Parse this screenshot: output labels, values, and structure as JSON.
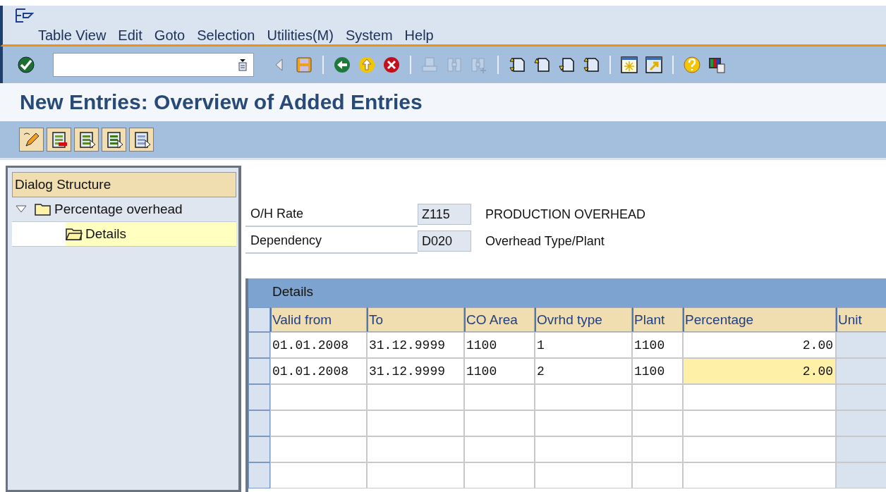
{
  "menu_bar": {
    "items": [
      {
        "label": "Table View"
      },
      {
        "label": "Edit"
      },
      {
        "label": "Goto"
      },
      {
        "label": "Selection"
      },
      {
        "label": "Utilities(M)"
      },
      {
        "label": "System"
      },
      {
        "label": "Help"
      }
    ]
  },
  "toolbar": {
    "buttons": [
      {
        "kind": "back-triangle",
        "disabled": false
      },
      {
        "kind": "save",
        "disabled": false
      },
      {
        "kind": "sep"
      },
      {
        "kind": "back",
        "disabled": false
      },
      {
        "kind": "exit",
        "disabled": false
      },
      {
        "kind": "cancel",
        "disabled": false
      },
      {
        "kind": "sep"
      },
      {
        "kind": "print",
        "disabled": true
      },
      {
        "kind": "find",
        "disabled": true
      },
      {
        "kind": "find-next",
        "disabled": true
      },
      {
        "kind": "sep"
      },
      {
        "kind": "first-page",
        "disabled": false
      },
      {
        "kind": "prev-page",
        "disabled": false
      },
      {
        "kind": "next-page",
        "disabled": false
      },
      {
        "kind": "last-page",
        "disabled": false
      },
      {
        "kind": "sep"
      },
      {
        "kind": "new-session",
        "disabled": false
      },
      {
        "kind": "shortcut",
        "disabled": false
      },
      {
        "kind": "sep"
      },
      {
        "kind": "help",
        "disabled": false
      },
      {
        "kind": "layout",
        "disabled": false
      }
    ]
  },
  "title": "New Entries: Overview of Added Entries",
  "app_toolbar": {
    "buttons": [
      {
        "kind": "change"
      },
      {
        "kind": "delete"
      },
      {
        "kind": "select-all"
      },
      {
        "kind": "select-block"
      },
      {
        "kind": "deselect-all"
      }
    ]
  },
  "dialog_structure": {
    "title": "Dialog Structure",
    "items": [
      {
        "label": "Percentage overhead",
        "expanded": true,
        "selected": false,
        "children": [
          {
            "label": "Details",
            "selected": true
          }
        ]
      }
    ]
  },
  "header_fields": [
    {
      "label": "O/H Rate",
      "value": "Z115",
      "description": "PRODUCTION OVERHEAD"
    },
    {
      "label": "Dependency",
      "value": "D020",
      "description": "Overhead Type/Plant"
    }
  ],
  "table": {
    "title": "Details",
    "columns": [
      "Valid from",
      "To",
      "CO Area",
      "Ovrhd type",
      "Plant",
      "Percentage",
      "Unit"
    ],
    "rows": [
      {
        "cells": [
          "01.01.2008",
          "31.12.9999",
          "1100",
          "1",
          "1100",
          "2.00",
          ""
        ],
        "focused_cell": false
      },
      {
        "cells": [
          "01.01.2008",
          "31.12.9999",
          "1100",
          "2",
          "1100",
          "2.00",
          ""
        ],
        "focused_cell": true
      }
    ]
  }
}
